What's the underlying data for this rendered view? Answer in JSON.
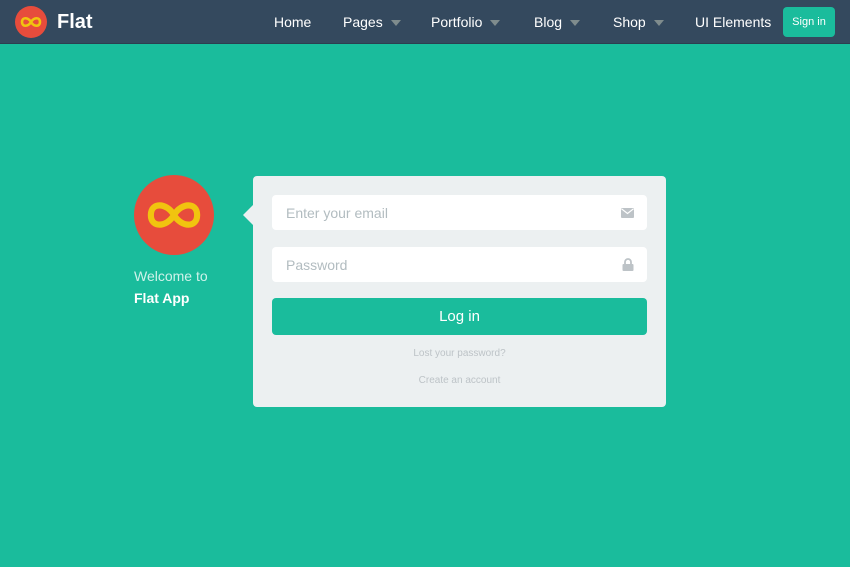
{
  "navbar": {
    "brand_name": "Flat",
    "items": [
      {
        "label": "Home",
        "has_dropdown": false
      },
      {
        "label": "Pages",
        "has_dropdown": true
      },
      {
        "label": "Portfolio",
        "has_dropdown": true
      },
      {
        "label": "Blog",
        "has_dropdown": true
      },
      {
        "label": "Shop",
        "has_dropdown": true
      },
      {
        "label": "UI Elements",
        "has_dropdown": false
      }
    ],
    "signin_label": "Sign in"
  },
  "welcome": {
    "line1": "Welcome to",
    "line2": "Flat App",
    "logo_icon": "infinity-icon"
  },
  "login": {
    "email_placeholder": "Enter your email",
    "email_icon": "envelope-icon",
    "password_placeholder": "Password",
    "password_icon": "lock-icon",
    "button_label": "Log in",
    "lost_password": "Lost your password?",
    "create_account": "Create an account"
  },
  "colors": {
    "background": "#1ABC9C",
    "navbar": "#34495E",
    "logo_circle": "#E74C3C",
    "logo_symbol": "#F1C40F",
    "panel": "#ECF0F1",
    "accent": "#1ABC9C"
  }
}
